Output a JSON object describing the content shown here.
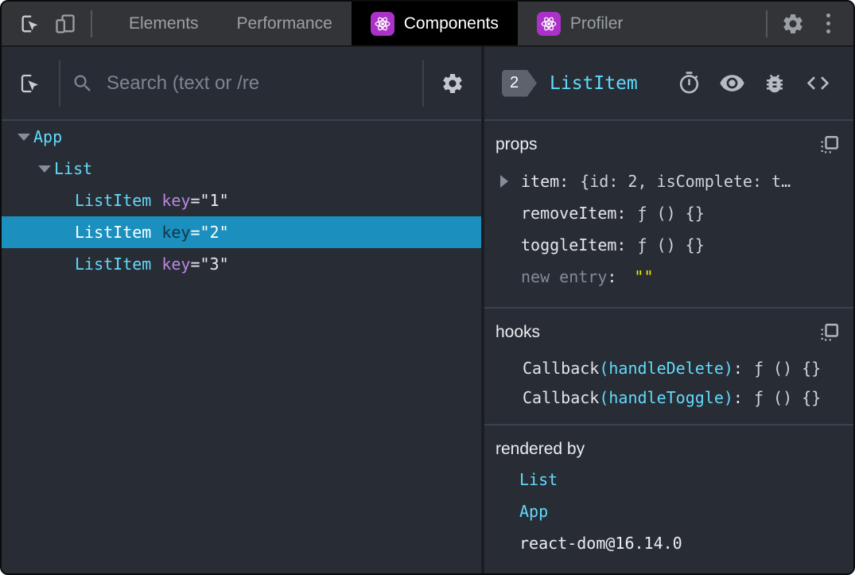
{
  "colors": {
    "accent_cyan": "#61dafb",
    "selected_row": "#1b8fbd",
    "attr_purple": "#bb87e0",
    "value_yellow": "#e9e900",
    "react_logo_bg": "#ab32c8",
    "active_tab_bg": "#000000"
  },
  "topbar": {
    "tabs": [
      {
        "label": "Elements",
        "active": false,
        "react_icon": false
      },
      {
        "label": "Performance",
        "active": false,
        "react_icon": false
      },
      {
        "label": "Components",
        "active": true,
        "react_icon": true
      },
      {
        "label": "Profiler",
        "active": false,
        "react_icon": true
      }
    ]
  },
  "left_panel": {
    "search_placeholder": "Search (text or /re",
    "tree": [
      {
        "depth": 0,
        "name": "App",
        "expanded": true,
        "selected": false,
        "key": null
      },
      {
        "depth": 1,
        "name": "List",
        "expanded": true,
        "selected": false,
        "key": null
      },
      {
        "depth": 2,
        "name": "ListItem",
        "expanded": false,
        "selected": false,
        "key": "1"
      },
      {
        "depth": 2,
        "name": "ListItem",
        "expanded": false,
        "selected": true,
        "key": "2"
      },
      {
        "depth": 2,
        "name": "ListItem",
        "expanded": false,
        "selected": false,
        "key": "3"
      }
    ]
  },
  "right_panel": {
    "badge": "2",
    "component_name": "ListItem",
    "props": {
      "title": "props",
      "rows": [
        {
          "name": "item",
          "value": "{id: 2, isComplete: t…",
          "expandable": true,
          "kind": "preview"
        },
        {
          "name": "removeItem",
          "value": "ƒ () {}",
          "expandable": false,
          "kind": "fn"
        },
        {
          "name": "toggleItem",
          "value": "ƒ () {}",
          "expandable": false,
          "kind": "fn"
        },
        {
          "name": "new entry",
          "value": "\"\"",
          "expandable": false,
          "kind": "new"
        }
      ]
    },
    "hooks": {
      "title": "hooks",
      "rows": [
        {
          "prefix": "Callback",
          "paren": "(handleDelete)",
          "colon": ":",
          "value": "ƒ () {}"
        },
        {
          "prefix": "Callback",
          "paren": "(handleToggle)",
          "colon": ":",
          "value": "ƒ () {}"
        }
      ]
    },
    "rendered_by": {
      "title": "rendered by",
      "rows": [
        {
          "label": "List",
          "link": true
        },
        {
          "label": "App",
          "link": true
        },
        {
          "label": "react-dom@16.14.0",
          "link": false
        }
      ]
    }
  }
}
